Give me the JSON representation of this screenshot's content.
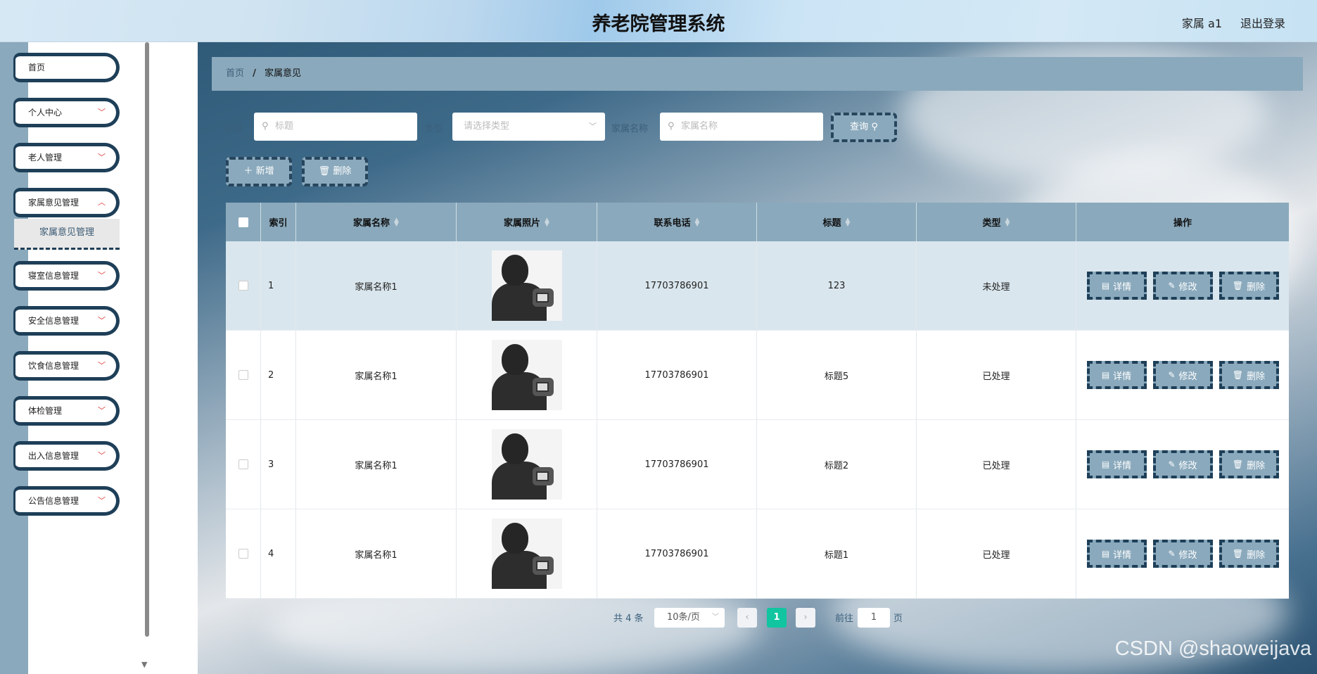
{
  "header": {
    "title": "养老院管理系统",
    "user": "家属 a1",
    "logout": "退出登录"
  },
  "sidebar": {
    "items": [
      {
        "label": "首页",
        "chevron": ""
      },
      {
        "label": "个人中心",
        "chevron": "﹀"
      },
      {
        "label": "老人管理",
        "chevron": "﹀"
      },
      {
        "label": "家属意见管理",
        "chevron": "︿"
      },
      {
        "label": "寝室信息管理",
        "chevron": "﹀"
      },
      {
        "label": "安全信息管理",
        "chevron": "﹀"
      },
      {
        "label": "饮食信息管理",
        "chevron": "﹀"
      },
      {
        "label": "体检管理",
        "chevron": "﹀"
      },
      {
        "label": "出入信息管理",
        "chevron": "﹀"
      },
      {
        "label": "公告信息管理",
        "chevron": "﹀"
      }
    ],
    "submenu": {
      "label": "家属意见管理"
    }
  },
  "breadcrumb": {
    "home": "首页",
    "separator": "/",
    "current": "家属意见"
  },
  "search": {
    "title_label": "标题",
    "title_placeholder": "标题",
    "type_label": "类型",
    "type_placeholder": "请选择类型",
    "name_label": "家属名称",
    "name_placeholder": "家属名称",
    "query_button": "查询"
  },
  "toolbar": {
    "add_label": "新增",
    "delete_label": "删除"
  },
  "table": {
    "headers": [
      "索引",
      "家属名称",
      "家属照片",
      "联系电话",
      "标题",
      "类型",
      "操作"
    ],
    "rows": [
      {
        "index": "1",
        "name": "家属名称1",
        "phone": "17703786901",
        "title": "123",
        "type": "未处理"
      },
      {
        "index": "2",
        "name": "家属名称1",
        "phone": "17703786901",
        "title": "标题5",
        "type": "已处理"
      },
      {
        "index": "3",
        "name": "家属名称1",
        "phone": "17703786901",
        "title": "标题2",
        "type": "已处理"
      },
      {
        "index": "4",
        "name": "家属名称1",
        "phone": "17703786901",
        "title": "标题1",
        "type": "已处理"
      }
    ],
    "actions": {
      "detail": "详情",
      "edit": "修改",
      "delete": "删除"
    }
  },
  "pagination": {
    "total": "共 4 条",
    "page_size": "10条/页",
    "current_page": "1",
    "goto_prefix": "前往",
    "goto_value": "1",
    "goto_suffix": "页"
  },
  "watermark": "CSDN @shaoweijava",
  "colors": {
    "accent": "#8aa9bc",
    "border_dark": "#1e3f58",
    "pager_active": "#10c5a0"
  }
}
